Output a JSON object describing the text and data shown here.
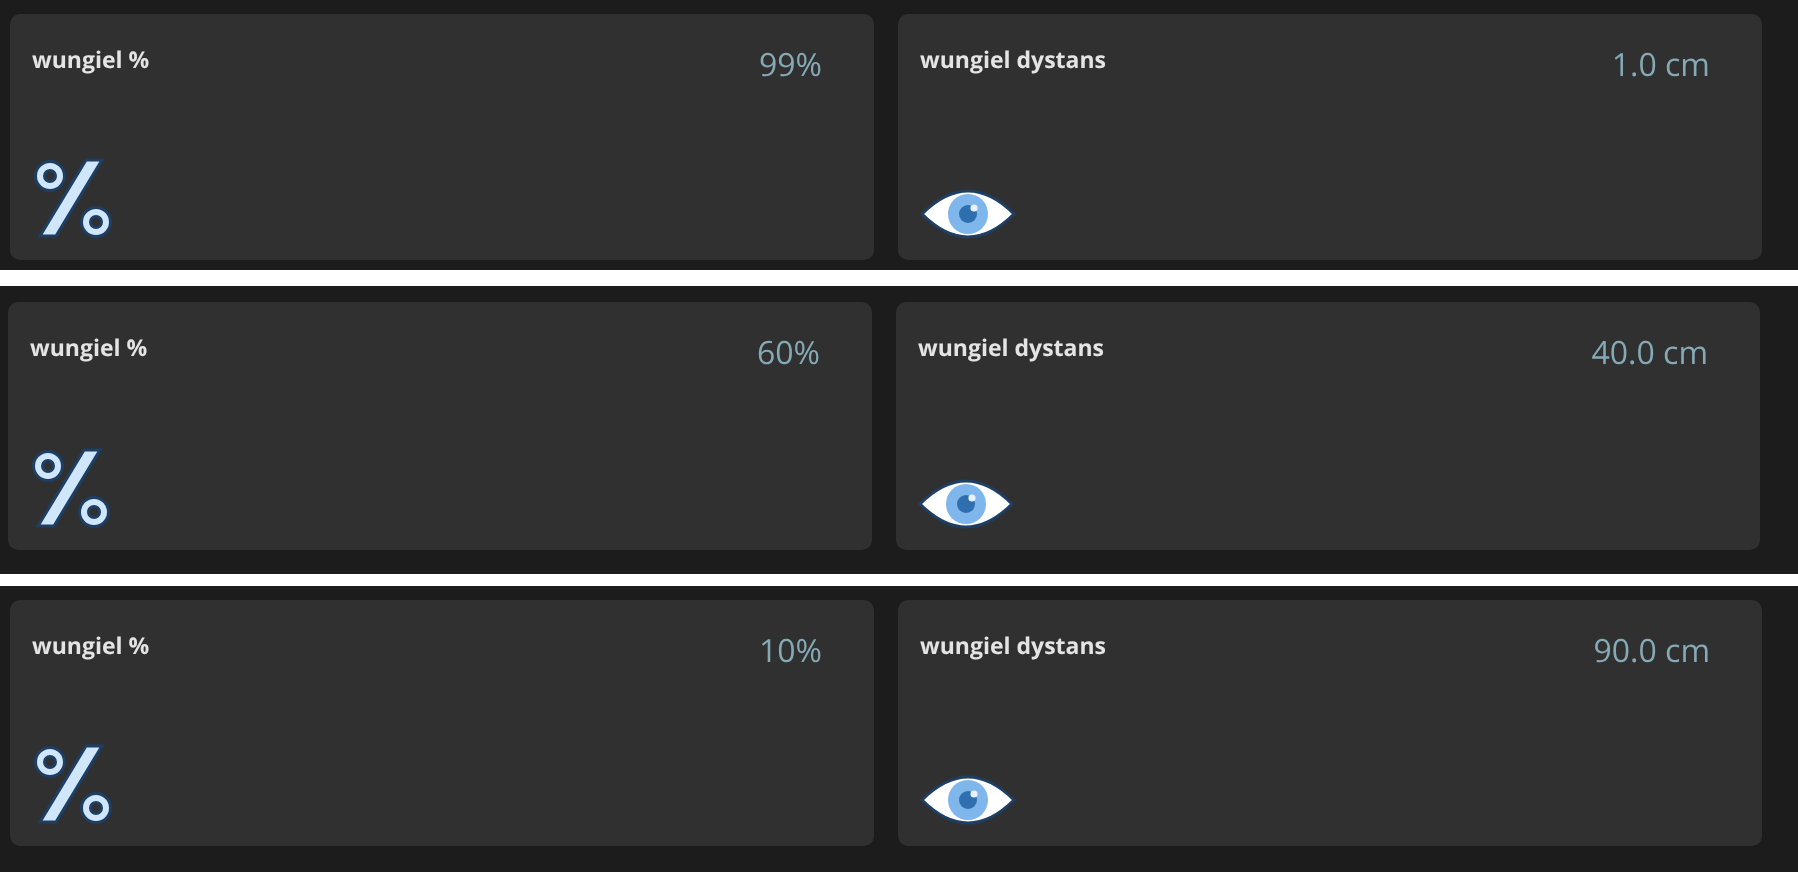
{
  "panels": [
    {
      "cards": [
        {
          "title": "wungiel %",
          "value": "99%",
          "kind": "percent"
        },
        {
          "title": "wungiel dystans",
          "value": "1.0 cm",
          "kind": "eye"
        }
      ]
    },
    {
      "cards": [
        {
          "title": "wungiel %",
          "value": "60%",
          "kind": "percent"
        },
        {
          "title": "wungiel dystans",
          "value": "40.0 cm",
          "kind": "eye"
        }
      ]
    },
    {
      "cards": [
        {
          "title": "wungiel %",
          "value": "10%",
          "kind": "percent"
        },
        {
          "title": "wungiel dystans",
          "value": "90.0 cm",
          "kind": "eye"
        }
      ]
    }
  ]
}
